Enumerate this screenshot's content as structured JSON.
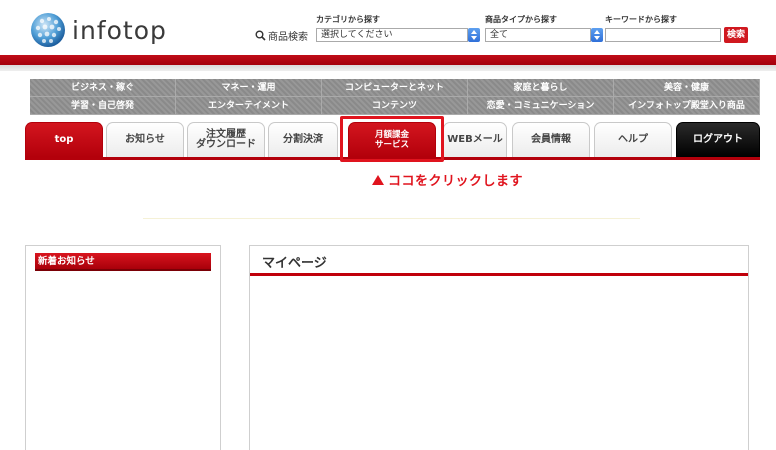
{
  "header": {
    "logo_text": "infotop",
    "search_label": "商品検索",
    "category_title": "カテゴリから探す",
    "category_value": "選択してください",
    "type_title": "商品タイプから探す",
    "type_value": "全て",
    "keyword_title": "キーワードから探す",
    "keyword_value": "",
    "search_button": "検索"
  },
  "categories": {
    "row1": [
      "ビジネス・稼ぐ",
      "マネー・運用",
      "コンピューターとネット",
      "家庭と暮らし",
      "美容・健康"
    ],
    "row2": [
      "学習・自己啓発",
      "エンターテイメント",
      "コンテンツ",
      "恋愛・コミュニケーション",
      "インフォトップ殿堂入り商品"
    ]
  },
  "tabs": [
    {
      "label": "top"
    },
    {
      "label": "お知らせ"
    },
    {
      "label": "注文履歴\nダウンロード"
    },
    {
      "label": "分割決済"
    },
    {
      "label": "月額課金\nサービス"
    },
    {
      "label": "WEBメール"
    },
    {
      "label": "会員情報"
    },
    {
      "label": "ヘルプ"
    },
    {
      "label": "ログアウト"
    }
  ],
  "callout": "ココをクリックします",
  "left_panel": {
    "title": "新着お知らせ"
  },
  "right_panel": {
    "title": "マイページ"
  },
  "colors": {
    "accent_red": "#c00d18",
    "highlight_red": "#e0141e",
    "logout_black": "#000000"
  }
}
